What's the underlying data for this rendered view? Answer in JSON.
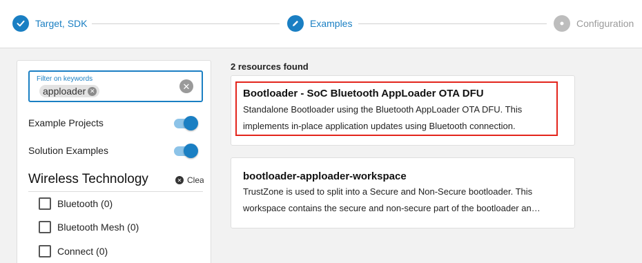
{
  "stepper": {
    "steps": [
      {
        "label": "Target, SDK",
        "state": "done",
        "icon": "check-icon"
      },
      {
        "label": "Examples",
        "state": "current",
        "icon": "pencil-icon"
      },
      {
        "label": "Configuration",
        "state": "pending",
        "icon": "dot-icon"
      }
    ],
    "active_color": "#1a7fc3",
    "inactive_color": "#bdbdbd"
  },
  "filters": {
    "keyword_label": "Filter on keywords",
    "keyword_chip": "apploader",
    "toggles": [
      {
        "label": "Example Projects",
        "on": true
      },
      {
        "label": "Solution Examples",
        "on": true
      }
    ],
    "section_title": "Wireless Technology",
    "clear_label": "Clea",
    "checkboxes": [
      {
        "label": "Bluetooth (0)",
        "checked": false
      },
      {
        "label": "Bluetooth Mesh (0)",
        "checked": false
      },
      {
        "label": "Connect (0)",
        "checked": false
      }
    ]
  },
  "results": {
    "count_text": "2 resources found",
    "cards": [
      {
        "title": "Bootloader - SoC Bluetooth AppLoader OTA DFU",
        "desc_line1": "Standalone Bootloader using the Bluetooth AppLoader OTA DFU. This",
        "desc_line2": "implements in-place application updates using Bluetooth connection.",
        "highlighted": true
      },
      {
        "title": "bootloader-apploader-workspace",
        "desc_line1": "TrustZone is used to split into a Secure and Non-Secure bootloader. This",
        "desc_line2": "workspace contains the secure and non-secure part of the bootloader an…",
        "highlighted": false
      }
    ],
    "highlight_color": "#e3241b"
  }
}
